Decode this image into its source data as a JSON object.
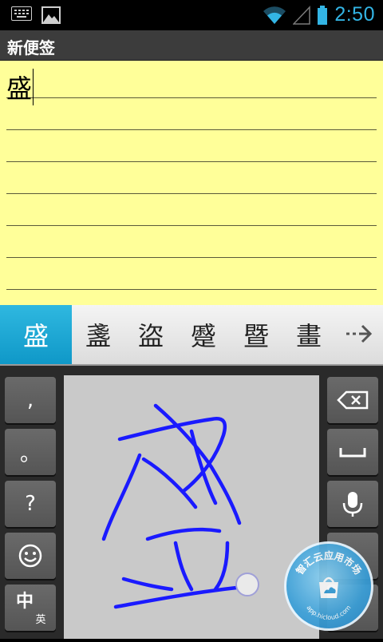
{
  "status_bar": {
    "time": "2:50"
  },
  "title_bar": {
    "title": "新便签"
  },
  "note": {
    "text": "盛"
  },
  "candidates": {
    "items": [
      "盛",
      "盞",
      "盜",
      "蹙",
      "暨",
      "畫"
    ],
    "selected_index": 0
  },
  "keyboard": {
    "left_keys": [
      ",",
      "。",
      "?"
    ],
    "lang_main": "中",
    "lang_sub": "英"
  },
  "watermark": {
    "brand": "智汇云应用市场",
    "url": "app.hicloud.com"
  },
  "colors": {
    "accent": "#33b5e5",
    "note_bg": "#ffff99",
    "candidate_selected": "#1aa8d6",
    "ink": "#1a1aff"
  }
}
